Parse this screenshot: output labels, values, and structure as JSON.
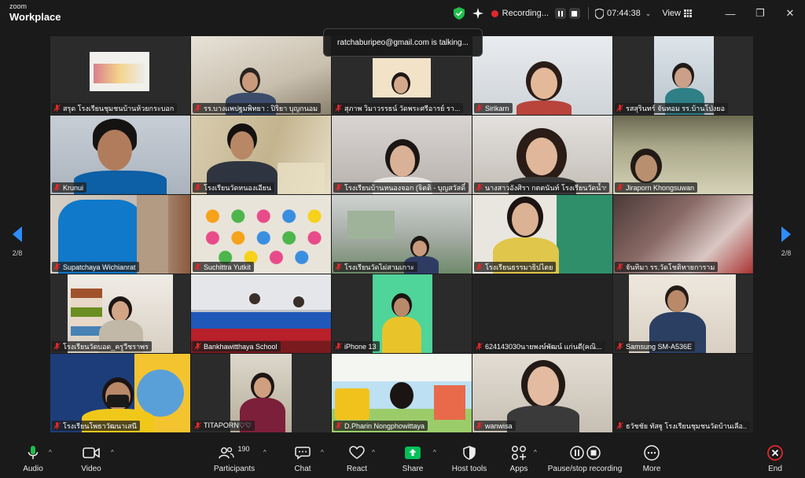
{
  "app": {
    "brand_top": "zoom",
    "brand_bottom": "Workplace"
  },
  "topbar": {
    "recording_label": "Recording...",
    "timer": "07:44:38",
    "view_label": "View",
    "window_controls": [
      "minimize",
      "restore",
      "close"
    ]
  },
  "speaker_toast": "ratchaburipeo@gmail.com is talking...",
  "pager": {
    "left_label": "2/8",
    "right_label": "2/8",
    "arrow_color": "#2d8cff"
  },
  "participants": [
    {
      "name": "สรุด โรงเรียนชุมชนบ้านห้วยกระบอก"
    },
    {
      "name": "รร.บางแพปฐมพิทยา : ปิริยา  บุญกนอม"
    },
    {
      "name": "สุภาพ  วิมาวรรธน์ วัดพระศรีอารย์ รา..."
    },
    {
      "name": "Sirikarn"
    },
    {
      "name": "รสสุรินทร์ จันทอม รร.บ้านโป่งยอ"
    },
    {
      "name": "Krunui"
    },
    {
      "name": "โรงเรียนวัดหนองเอียน"
    },
    {
      "name": "โรงเรียนบ้านหนองจอก (จิตติ - บุญสวัสดิ์)"
    },
    {
      "name": "นางสาวอังศิรา กตตนันท์ โรงเรียนวัดน้ำพุ"
    },
    {
      "name": "Jiraporn Khongsuwan"
    },
    {
      "name": "Supatchaya Wichianrat"
    },
    {
      "name": "Suchittra Yutkit"
    },
    {
      "name": "โรงเรียนวัดไผ่สามเกาะ"
    },
    {
      "name": "โรงเรียนธรรมาธิปไตย"
    },
    {
      "name": "จันทิมา รร.วัดโชติทายการาม"
    },
    {
      "name": "โรงเรียนวัดบอด_ครูวีชราพร"
    },
    {
      "name": "Bankhawitthaya School"
    },
    {
      "name": "iPhone 13"
    },
    {
      "name": "624143030นายพงษ์พัฒน์ แก่นดี(คณิ..."
    },
    {
      "name": "Samsung SM-A536E"
    },
    {
      "name": "โรงเรียนโพธาวัฒนาเสนี"
    },
    {
      "name": "TITAPORN♡♡"
    },
    {
      "name": "D.Pharin Nongphowittaya"
    },
    {
      "name": "wanwisa"
    },
    {
      "name": "ธวัชชัย ทัสฐู โรงเรียนชุมชนวัดบ้านเลือ..."
    }
  ],
  "toolbar": {
    "audio": "Audio",
    "video": "Video",
    "participants": "Participants",
    "participants_count": "190",
    "chat": "Chat",
    "react": "React",
    "share": "Share",
    "host_tools": "Host tools",
    "apps": "Apps",
    "recording": "Pause/stop recording",
    "more": "More",
    "end": "End",
    "share_color": "#00c05a",
    "end_color": "#e02828"
  }
}
